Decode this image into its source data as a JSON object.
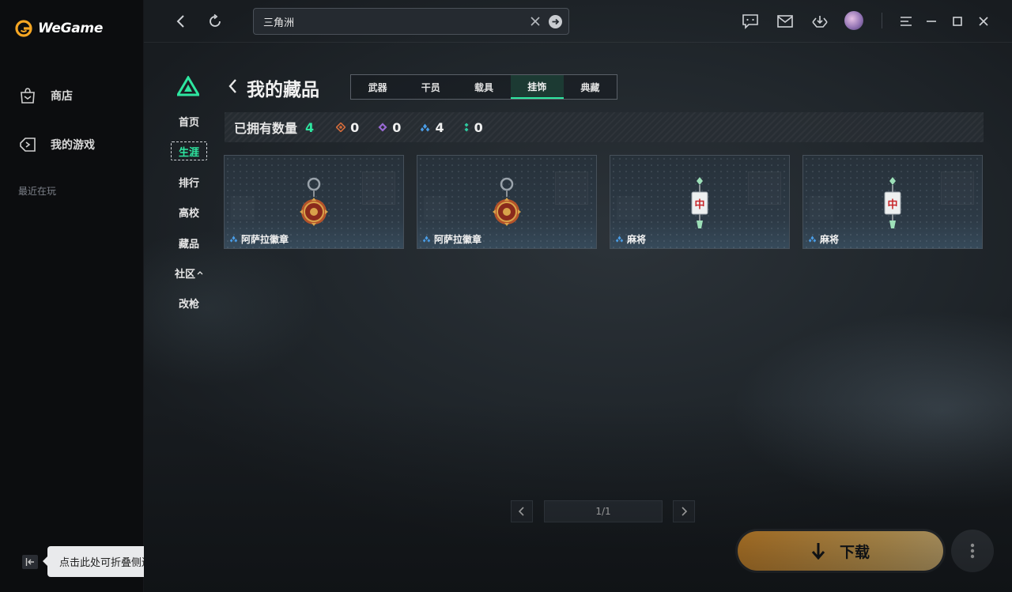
{
  "app": {
    "brand": "WeGame"
  },
  "sidebar": {
    "items": [
      {
        "label": "商店",
        "icon": "store-bag-icon"
      },
      {
        "label": "我的游戏",
        "icon": "gamepad-icon"
      }
    ],
    "recent_label": "最近在玩",
    "collapse_tip": "点击此处可折叠侧边栏"
  },
  "search": {
    "value": "三角洲"
  },
  "game_nav": {
    "items": [
      "首页",
      "生涯",
      "排行",
      "高校",
      "藏品",
      "社区",
      "改枪"
    ],
    "active": "生涯"
  },
  "header": {
    "title": "我的藏品"
  },
  "tabs": {
    "items": [
      "武器",
      "干员",
      "载具",
      "挂饰",
      "典藏"
    ],
    "active": "挂饰"
  },
  "counts": {
    "owned_label": "已拥有数量",
    "owned_value": "4",
    "by_rarity": [
      {
        "value": "0",
        "color": "#d06a3a"
      },
      {
        "value": "0",
        "color": "#9a6ad6"
      },
      {
        "value": "4",
        "color": "#4a9de6"
      },
      {
        "value": "0",
        "color": "#2ec9a0"
      }
    ]
  },
  "items": [
    {
      "name": "阿萨拉徽章",
      "art": "medal-charm-icon"
    },
    {
      "name": "阿萨拉徽章",
      "art": "medal-charm-icon"
    },
    {
      "name": "麻将",
      "art": "mahjong-charm-icon"
    },
    {
      "name": "麻将",
      "art": "mahjong-charm-icon"
    }
  ],
  "pagination": {
    "indicator": "1/1"
  },
  "download": {
    "label": "下载"
  },
  "colors": {
    "accent": "#2ee6a0",
    "download": "#f7a12f"
  }
}
